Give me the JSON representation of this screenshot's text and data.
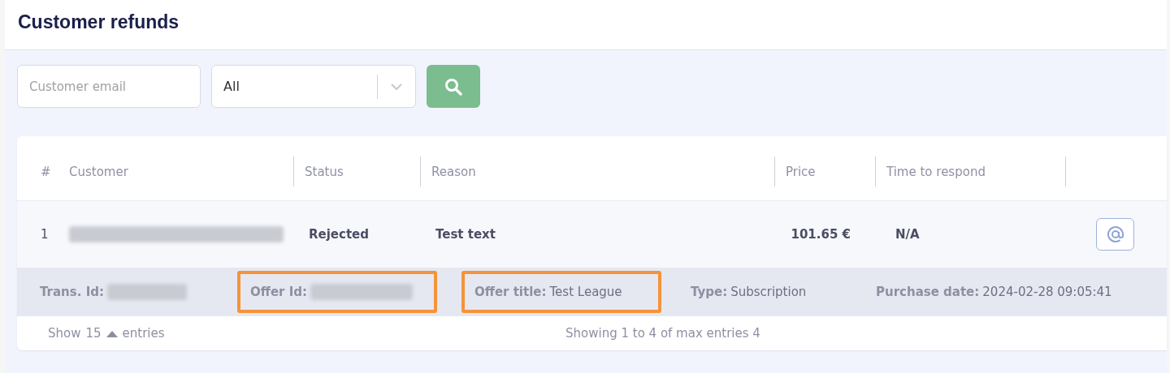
{
  "page": {
    "title": "Customer refunds"
  },
  "filters": {
    "email": {
      "placeholder": "Customer email"
    },
    "status_select": {
      "value": "All"
    }
  },
  "table": {
    "columns": [
      "#",
      "Customer",
      "Status",
      "Reason",
      "Price",
      "Time to respond"
    ],
    "rows": [
      {
        "number": "1",
        "customer_redacted": true,
        "status": "Rejected",
        "reason": "Test text",
        "price": "101.65 €",
        "time_to_respond": "N/A",
        "details": [
          {
            "label": "Trans. Id:",
            "redacted": true,
            "highlighted": false
          },
          {
            "label": "Offer Id:",
            "redacted": true,
            "highlighted": true
          },
          {
            "label": "Offer title:",
            "value": "Test League",
            "highlighted": true
          },
          {
            "label": "Type:",
            "value": "Subscription",
            "highlighted": false
          },
          {
            "label": "Purchase date:",
            "value": "2024-02-28 09:05:41",
            "highlighted": false
          }
        ]
      }
    ]
  },
  "footer": {
    "show_label": "Show",
    "page_size": "15",
    "entries_label": "entries",
    "summary": "Showing 1 to 4 of max entries 4"
  }
}
